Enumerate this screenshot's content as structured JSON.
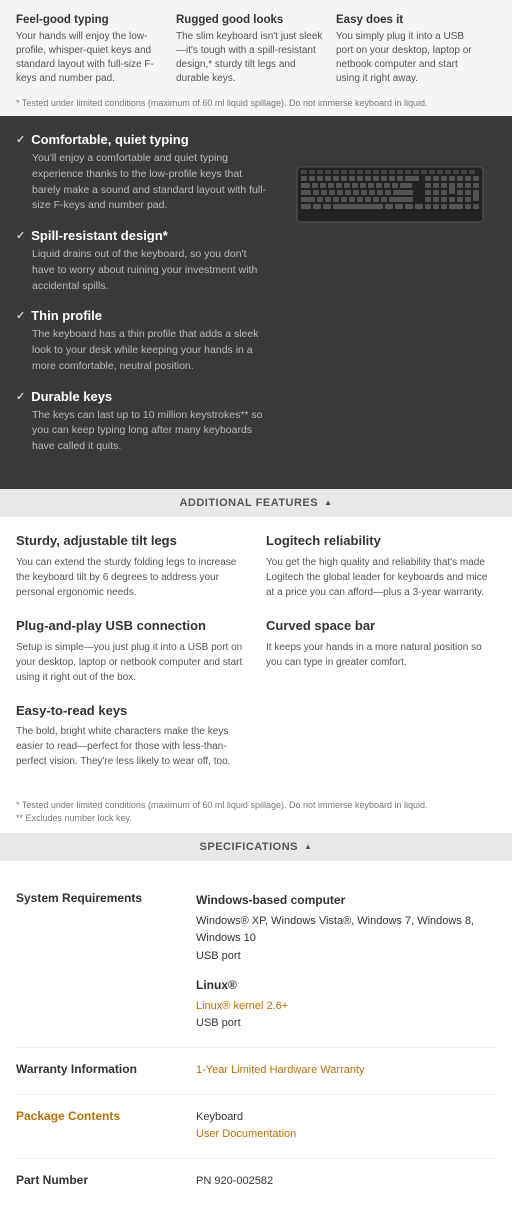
{
  "topBanner": {
    "cols": [
      {
        "title": "Feel-good typing",
        "desc": "Your hands will enjoy the low-profile, whisper-quiet keys and standard layout with full-size F-keys and number pad."
      },
      {
        "title": "Rugged good looks",
        "desc": "The slim keyboard isn't just sleek—it's tough with a spill-resistant design,* sturdy tilt legs and durable keys."
      },
      {
        "title": "Easy does it",
        "desc": "You simply plug it into a USB port on your desktop, laptop or netbook computer and start using it right away."
      }
    ],
    "disclaimer": "* Tested under limited conditions (maximum of 60 ml liquid spillage). Do not immerse keyboard in liquid."
  },
  "darkSection": {
    "features": [
      {
        "title": "Comfortable, quiet typing",
        "desc": "You'll enjoy a comfortable and quiet typing experience thanks to the low-profile keys that barely make a sound and standard layout with full-size F-keys and number pad."
      },
      {
        "title": "Spill-resistant design*",
        "desc": "Liquid drains out of the keyboard, so you don't have to worry about ruining your investment with accidental spills."
      },
      {
        "title": "Thin profile",
        "desc": "The keyboard has a thin profile that adds a sleek look to your desk while keeping your hands in a more comfortable, neutral position."
      },
      {
        "title": "Durable keys",
        "desc": "The keys can last up to 10 million keystrokes** so you can keep typing long after many keyboards have called it quits."
      }
    ]
  },
  "additionalSection": {
    "header": "ADDITIONAL FEATURES"
  },
  "featuresGrid": {
    "left": [
      {
        "title": "Sturdy, adjustable tilt legs",
        "desc": "You can extend the sturdy folding legs to increase the keyboard tilt by 6 degrees to address your personal ergonomic needs."
      },
      {
        "title": "Plug-and-play USB connection",
        "desc": "Setup is simple—you just plug it into a USB port on your desktop, laptop or netbook computer and start using it right out of the box."
      },
      {
        "title": "Easy-to-read keys",
        "desc": "The bold, bright white characters make the keys easier to read—perfect for those with less-than-perfect vision. They're less likely to wear off, too."
      }
    ],
    "right": [
      {
        "title": "Logitech reliability",
        "desc": "You get the high quality and reliability that's made Logitech the global leader for keyboards and mice at a price you can afford—plus a 3-year warranty."
      },
      {
        "title": "Curved space bar",
        "desc": "It keeps your hands in a more natural position so you can type in greater comfort."
      }
    ],
    "disclaimers": [
      "* Tested under limited conditions (maximum of 60 ml liquid spillage). Do not immerse keyboard in liquid.",
      "** Excludes number lock key."
    ]
  },
  "specsSection": {
    "header": "SPECIFICATIONS",
    "rows": [
      {
        "label": "System Requirements",
        "type": "system",
        "windows": {
          "title": "Windows-based computer",
          "lines": [
            "Windows® XP, Windows Vista®, Windows 7, Windows 8, Windows 10",
            "USB port"
          ]
        },
        "linux": {
          "title": "Linux®",
          "link": "Linux® kernel 2.6+",
          "lines": [
            "USB port"
          ]
        }
      },
      {
        "label": "Warranty Information",
        "type": "warranty",
        "value": "1-Year Limited Hardware Warranty"
      },
      {
        "label": "Package Contents",
        "type": "package",
        "lines": [
          "Keyboard",
          "User Documentation"
        ]
      },
      {
        "label": "Part Number",
        "type": "text",
        "value": "PN 920-002582"
      }
    ]
  }
}
